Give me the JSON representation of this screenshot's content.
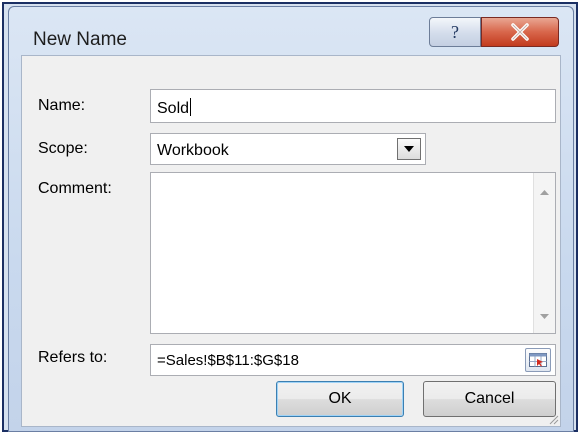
{
  "dialog": {
    "title": "New Name",
    "help_glyph": "?",
    "close_glyph": "X"
  },
  "form": {
    "name_label": "Name:",
    "name_value": "Sold",
    "scope_label": "Scope:",
    "scope_value": "Workbook",
    "comment_label": "Comment:",
    "comment_value": "",
    "refers_label": "Refers to:",
    "refers_value": "=Sales!$B$11:$G$18"
  },
  "buttons": {
    "ok": "OK",
    "cancel": "Cancel"
  },
  "colors": {
    "frame": "#1b2f63",
    "close_red": "#c23b1e",
    "dialog_bg": "#f0f0f0"
  }
}
